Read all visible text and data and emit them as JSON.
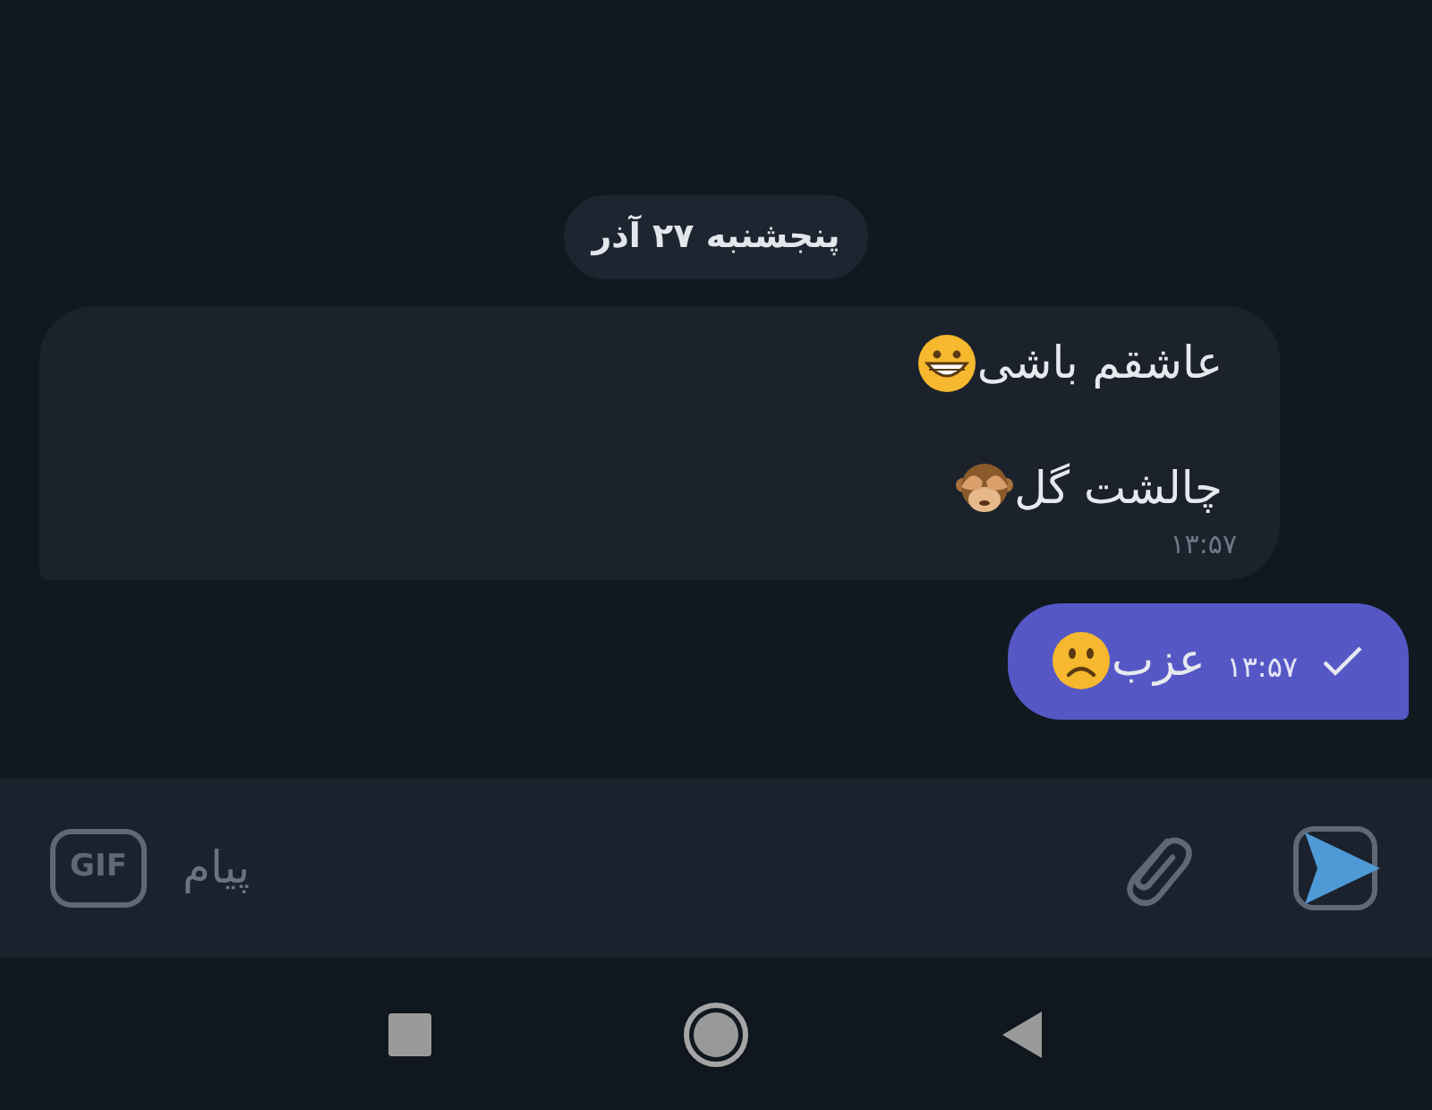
{
  "date_chip": "پنجشنبه ۲۷ آذر",
  "messages": [
    {
      "kind": "incoming",
      "lines": [
        {
          "text": "عاشقم باشی",
          "kind": "grin"
        },
        {
          "text": "چالشت گل",
          "kind": "monkey"
        }
      ],
      "time": "۱۳:۵۷"
    },
    {
      "kind": "outgoing",
      "lines": [
        {
          "text": "عزب",
          "kind": "frown"
        }
      ],
      "time": "۱۳:۵۷",
      "read": false
    }
  ],
  "composer": {
    "placeholder": "پیام",
    "gif_label": "GIF"
  }
}
